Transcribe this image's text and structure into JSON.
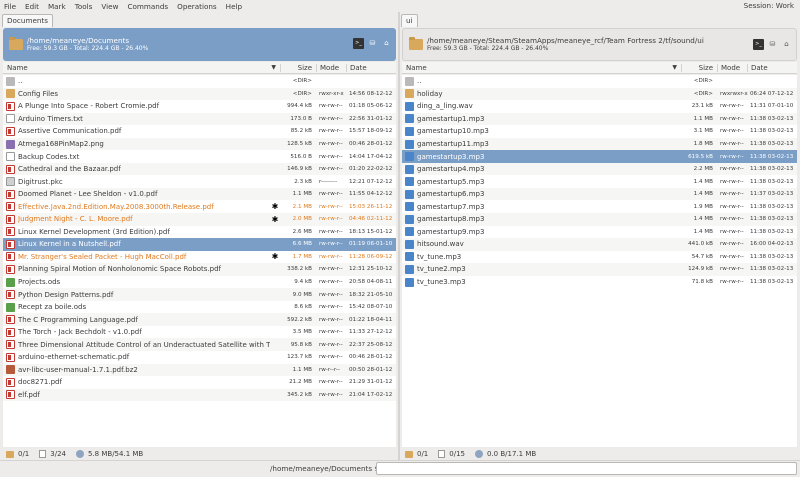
{
  "menu": [
    "File",
    "Edit",
    "Mark",
    "Tools",
    "View",
    "Commands",
    "Operations",
    "Help"
  ],
  "session": "Session: Work",
  "left": {
    "tab": "Documents",
    "path": "/home/meaneye/Documents",
    "free": "Free: 59.3 GB - Total: 224.4 GB - 26.40%",
    "columns": {
      "name": "Name",
      "size": "Size",
      "mode": "Mode",
      "date": "Date"
    },
    "rows": [
      {
        "icon": "up",
        "name": "..",
        "star": "",
        "size": "<DIR>",
        "mode": "",
        "date": ""
      },
      {
        "icon": "dir",
        "name": "Config Files",
        "star": "",
        "size": "<DIR>",
        "mode": "rwxr-xr-x",
        "date": "14:56 08-12-12"
      },
      {
        "icon": "pdf",
        "name": "A Plunge Into Space - Robert Cromie.pdf",
        "star": "",
        "size": "994.4 kB",
        "mode": "rw-rw-r--",
        "date": "01:18 05-06-12"
      },
      {
        "icon": "txt",
        "name": "Arduino Timers.txt",
        "star": "",
        "size": "173.0 B",
        "mode": "rw-rw-r--",
        "date": "22:56 31-01-12"
      },
      {
        "icon": "pdf",
        "name": "Assertive Communication.pdf",
        "star": "",
        "size": "85.2 kB",
        "mode": "rw-rw-r--",
        "date": "15:57 18-09-12"
      },
      {
        "icon": "img",
        "name": "Atmega168PinMap2.png",
        "star": "",
        "size": "128.5 kB",
        "mode": "rw-rw-r--",
        "date": "00:46 28-01-12"
      },
      {
        "icon": "txt",
        "name": "Backup Codes.txt",
        "star": "",
        "size": "516.0 B",
        "mode": "rw-rw-r--",
        "date": "14:04 17-04-12"
      },
      {
        "icon": "pdf",
        "name": "Cathedral and the Bazaar.pdf",
        "star": "",
        "size": "146.9 kB",
        "mode": "rw-rw-r--",
        "date": "01:20 22-02-12"
      },
      {
        "icon": "bin",
        "name": "Digitrust.pkc",
        "star": "",
        "size": "2.3 kB",
        "mode": "r--------",
        "date": "12:21 07-12-12"
      },
      {
        "icon": "pdf",
        "name": "Doomed Planet - Lee Sheldon - v1.0.pdf",
        "star": "",
        "size": "1.1 MB",
        "mode": "rw-rw-r--",
        "date": "11:55 04-12-12"
      },
      {
        "icon": "pdf",
        "name": "Effective.Java.2nd.Edition.May.2008.3000th.Release.pdf",
        "star": "✱",
        "size": "2.1 MB",
        "mode": "rw-rw-r--",
        "date": "15:03 26-11-12",
        "mark": true
      },
      {
        "icon": "pdf",
        "name": "Judgment Night - C. L. Moore.pdf",
        "star": "✱",
        "size": "2.0 MB",
        "mode": "rw-rw-r--",
        "date": "04:46 02-11-12",
        "mark": true
      },
      {
        "icon": "pdf",
        "name": "Linux Kernel Development (3rd Edition).pdf",
        "star": "",
        "size": "2.6 MB",
        "mode": "rw-rw-r--",
        "date": "18:13 15-01-12"
      },
      {
        "icon": "pdf",
        "name": "Linux Kernel in a Nutshell.pdf",
        "star": "",
        "size": "6.6 MB",
        "mode": "rw-rw-r--",
        "date": "01:19 06-01-10",
        "sel": true
      },
      {
        "icon": "pdf",
        "name": "Mr. Stranger's Sealed Packet - Hugh MacColl.pdf",
        "star": "✱",
        "size": "1.7 MB",
        "mode": "rw-rw-r--",
        "date": "11:28 06-09-12",
        "mark": true
      },
      {
        "icon": "pdf",
        "name": "Planning Spiral Motion of Nonholonomic Space Robots.pdf",
        "star": "",
        "size": "338.2 kB",
        "mode": "rw-rw-r--",
        "date": "12:31 25-10-12"
      },
      {
        "icon": "ods",
        "name": "Projects.ods",
        "star": "",
        "size": "9.4 kB",
        "mode": "rw-rw-r--",
        "date": "20:58 04-08-11"
      },
      {
        "icon": "pdf",
        "name": "Python Design Patterns.pdf",
        "star": "",
        "size": "9.0 MB",
        "mode": "rw-rw-r--",
        "date": "18:32 21-05-10"
      },
      {
        "icon": "ods",
        "name": "Recept za boile.ods",
        "star": "",
        "size": "8.6 kB",
        "mode": "rw-rw-r--",
        "date": "15:42 08-07-10"
      },
      {
        "icon": "pdf",
        "name": "The C Programming Language.pdf",
        "star": "",
        "size": "592.2 kB",
        "mode": "rw-rw-r--",
        "date": "01:22 18-04-11"
      },
      {
        "icon": "pdf",
        "name": "The Torch - Jack Bechdolt - v1.0.pdf",
        "star": "",
        "size": "3.5 MB",
        "mode": "rw-rw-r--",
        "date": "11:33 27-12-12"
      },
      {
        "icon": "pdf",
        "name": "Three Dimensional Attitude Control of an Underactuated Satellite with Thrusters.pdf",
        "star": "",
        "size": "95.8 kB",
        "mode": "rw-rw-r--",
        "date": "22:37 25-08-12"
      },
      {
        "icon": "pdf",
        "name": "arduino-ethernet-schematic.pdf",
        "star": "",
        "size": "123.7 kB",
        "mode": "rw-rw-r--",
        "date": "00:46 28-01-12"
      },
      {
        "icon": "arc",
        "name": "avr-libc-user-manual-1.7.1.pdf.bz2",
        "star": "",
        "size": "1.1 MB",
        "mode": "rw-r--r--",
        "date": "00:50 28-01-12"
      },
      {
        "icon": "pdf",
        "name": "doc8271.pdf",
        "star": "",
        "size": "21.2 MB",
        "mode": "rw-rw-r--",
        "date": "21:29 31-01-12"
      },
      {
        "icon": "pdf",
        "name": "elf.pdf",
        "star": "",
        "size": "345.2 kB",
        "mode": "rw-rw-r--",
        "date": "21:04 17-02-12"
      }
    ],
    "status": {
      "dirs": "0/1",
      "files": "3/24",
      "size": "5.8 MB/54.1 MB"
    }
  },
  "right": {
    "tab": "ui",
    "path": "/home/meaneye/Steam/SteamApps/meaneye_rcf/Team Fortress 2/tf/sound/ui",
    "free": "Free: 59.3 GB - Total: 224.4 GB - 26.40%",
    "columns": {
      "name": "Name",
      "size": "Size",
      "mode": "Mode",
      "date": "Date"
    },
    "rows": [
      {
        "icon": "up",
        "name": "..",
        "star": "",
        "size": "<DIR>",
        "mode": "",
        "date": ""
      },
      {
        "icon": "dir",
        "name": "holiday",
        "star": "",
        "size": "<DIR>",
        "mode": "rwxrwxr-x",
        "date": "06:24 07-12-12"
      },
      {
        "icon": "aud",
        "name": "ding_a_ling.wav",
        "star": "",
        "size": "23.1 kB",
        "mode": "rw-rw-r--",
        "date": "11:31 07-01-10"
      },
      {
        "icon": "aud",
        "name": "gamestartup1.mp3",
        "star": "",
        "size": "1.1 MB",
        "mode": "rw-rw-r--",
        "date": "11:38 03-02-13"
      },
      {
        "icon": "aud",
        "name": "gamestartup10.mp3",
        "star": "",
        "size": "3.1 MB",
        "mode": "rw-rw-r--",
        "date": "11:38 03-02-13"
      },
      {
        "icon": "aud",
        "name": "gamestartup11.mp3",
        "star": "",
        "size": "1.8 MB",
        "mode": "rw-rw-r--",
        "date": "11:38 03-02-13"
      },
      {
        "icon": "aud",
        "name": "gamestartup3.mp3",
        "star": "",
        "size": "619.5 kB",
        "mode": "rw-rw-r--",
        "date": "11:38 03-02-13",
        "sel": true
      },
      {
        "icon": "aud",
        "name": "gamestartup4.mp3",
        "star": "",
        "size": "2.2 MB",
        "mode": "rw-rw-r--",
        "date": "11:38 03-02-13"
      },
      {
        "icon": "aud",
        "name": "gamestartup5.mp3",
        "star": "",
        "size": "1.4 MB",
        "mode": "rw-rw-r--",
        "date": "11:38 03-02-13"
      },
      {
        "icon": "aud",
        "name": "gamestartup6.mp3",
        "star": "",
        "size": "1.4 MB",
        "mode": "rw-rw-r--",
        "date": "11:37 03-02-13"
      },
      {
        "icon": "aud",
        "name": "gamestartup7.mp3",
        "star": "",
        "size": "1.9 MB",
        "mode": "rw-rw-r--",
        "date": "11:38 03-02-13"
      },
      {
        "icon": "aud",
        "name": "gamestartup8.mp3",
        "star": "",
        "size": "1.4 MB",
        "mode": "rw-rw-r--",
        "date": "11:38 03-02-13"
      },
      {
        "icon": "aud",
        "name": "gamestartup9.mp3",
        "star": "",
        "size": "1.4 MB",
        "mode": "rw-rw-r--",
        "date": "11:38 03-02-13"
      },
      {
        "icon": "aud",
        "name": "hitsound.wav",
        "star": "",
        "size": "441.0 kB",
        "mode": "rw-rw-r--",
        "date": "16:00 04-02-13"
      },
      {
        "icon": "aud",
        "name": "tv_tune.mp3",
        "star": "",
        "size": "54.7 kB",
        "mode": "rw-rw-r--",
        "date": "11:38 03-02-13"
      },
      {
        "icon": "aud",
        "name": "tv_tune2.mp3",
        "star": "",
        "size": "124.9 kB",
        "mode": "rw-rw-r--",
        "date": "11:38 03-02-13"
      },
      {
        "icon": "aud",
        "name": "tv_tune3.mp3",
        "star": "",
        "size": "71.8 kB",
        "mode": "rw-rw-r--",
        "date": "11:38 03-02-13"
      }
    ],
    "status": {
      "dirs": "0/1",
      "files": "0/15",
      "size": "0.0 B/17.1 MB"
    }
  },
  "command": {
    "path": "/home/meaneye/Documents $",
    "value": ""
  },
  "colors": {
    "selection": "#7b9ec7",
    "marked": "#e07a1f",
    "folder": "#d8a85c"
  }
}
